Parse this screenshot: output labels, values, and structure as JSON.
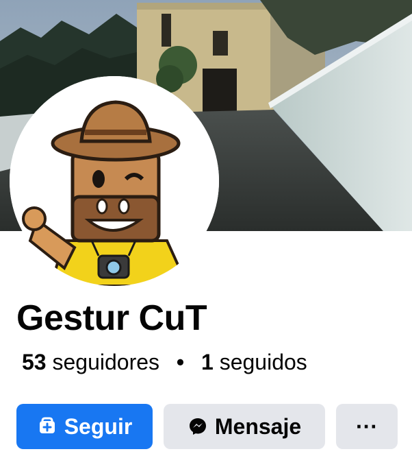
{
  "profile": {
    "name": "Gestur CuT",
    "followers_count": "53",
    "followers_label": "seguidores",
    "separator": "•",
    "following_count": "1",
    "following_label": "seguidos"
  },
  "actions": {
    "follow_label": "Seguir",
    "message_label": "Mensaje",
    "more_label": "···"
  },
  "icons": {
    "follow": "add-friend-icon",
    "message": "messenger-icon"
  },
  "colors": {
    "primary": "#1877f2",
    "secondary_button": "#e4e6eb",
    "text": "#050505"
  }
}
